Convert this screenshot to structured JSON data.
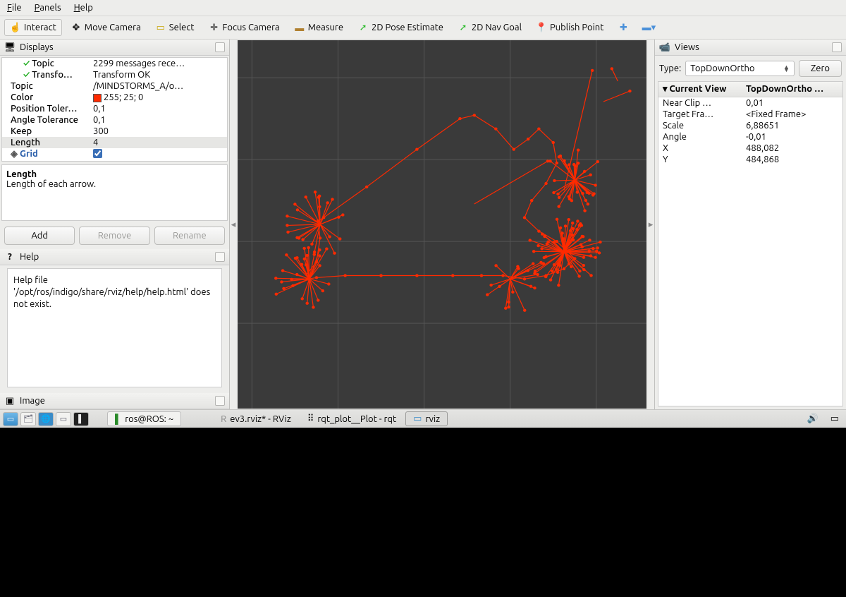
{
  "menubar": {
    "file": "File",
    "panels": "Panels",
    "help": "Help"
  },
  "toolbar": {
    "interact": "Interact",
    "move_camera": "Move Camera",
    "select": "Select",
    "focus_camera": "Focus Camera",
    "measure": "Measure",
    "pose_estimate": "2D Pose Estimate",
    "nav_goal": "2D Nav Goal",
    "publish_point": "Publish Point"
  },
  "displays_panel": {
    "title": "Displays",
    "rows": {
      "topic_status_k": "Topic",
      "topic_status_v": "2299 messages rece…",
      "transfo_k": "Transfo…",
      "transfo_v": "Transform OK",
      "topic_k": "Topic",
      "topic_v": "/MINDSTORMS_A/o…",
      "color_k": "Color",
      "color_v": "255; 25; 0",
      "postol_k": "Position Toler…",
      "postol_v": "0,1",
      "angtol_k": "Angle Tolerance",
      "angtol_v": "0,1",
      "keep_k": "Keep",
      "keep_v": "300",
      "length_k": "Length",
      "length_v": "4",
      "grid_k": "Grid"
    },
    "desc_title": "Length",
    "desc_body": "Length of each arrow.",
    "buttons": {
      "add": "Add",
      "remove": "Remove",
      "rename": "Rename"
    }
  },
  "help_panel": {
    "title": "Help",
    "body": "Help file '/opt/ros/indigo/share/rviz/help/help.html' does not exist."
  },
  "image_panel": {
    "title": "Image"
  },
  "views_panel": {
    "title": "Views",
    "type_label": "Type:",
    "type_value": "TopDownOrtho",
    "zero": "Zero",
    "header_k": "Current View",
    "header_v": "TopDownOrtho …",
    "rows": {
      "nearclip_k": "Near Clip …",
      "nearclip_v": "0,01",
      "targetfra_k": "Target Fra…",
      "targetfra_v": "<Fixed Frame>",
      "scale_k": "Scale",
      "scale_v": "6,88651",
      "angle_k": "Angle",
      "angle_v": "-0,01",
      "x_k": "X",
      "x_v": "488,082",
      "y_k": "Y",
      "y_v": "484,868"
    }
  },
  "taskbar": {
    "terminal": "ros@ROS: ~",
    "task1": "ev3.rviz* - RViz",
    "task2": "rqt_plot__Plot - rqt",
    "task3": "rviz"
  }
}
